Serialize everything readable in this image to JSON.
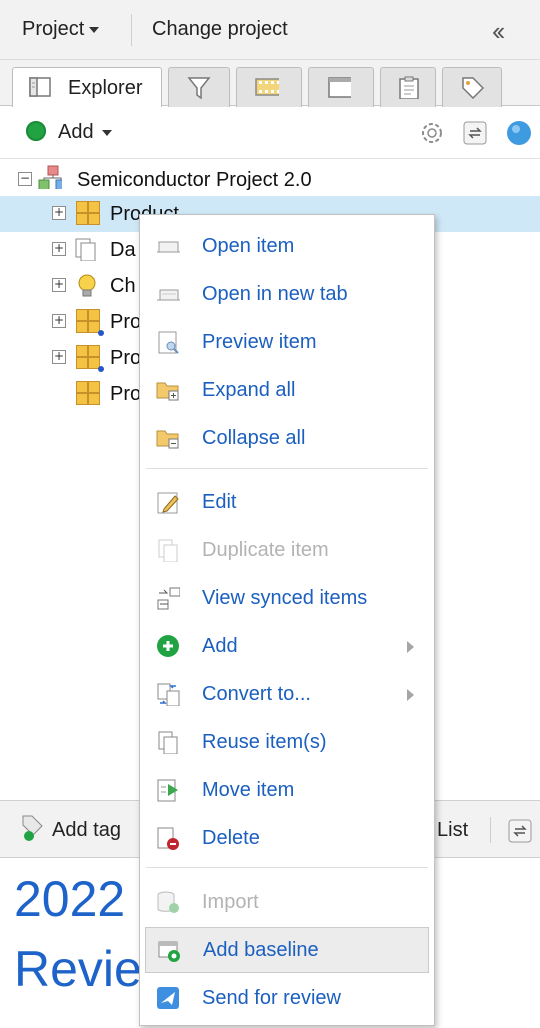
{
  "header": {
    "project_label": "Project",
    "change_project_label": "Change project",
    "collapse_icon": "double-chevron-left-icon"
  },
  "tabs": [
    {
      "label": "Explorer",
      "icon": "explorer-icon",
      "active": true
    },
    {
      "label": "",
      "icon": "filter-icon"
    },
    {
      "label": "",
      "icon": "film-strip-icon"
    },
    {
      "label": "",
      "icon": "window-icon"
    },
    {
      "label": "",
      "icon": "clipboard-icon"
    },
    {
      "label": "",
      "icon": "tag-icon"
    }
  ],
  "toolbar": {
    "add_label": "Add"
  },
  "tree": {
    "root": "Semiconductor Project 2.0",
    "items": [
      {
        "label": "Product",
        "selected": true
      },
      {
        "label": "Da"
      },
      {
        "label": "Ch"
      },
      {
        "label": "Pro"
      },
      {
        "label": "Pro"
      },
      {
        "label": "Pro"
      }
    ]
  },
  "bottom": {
    "add_tag_label": "Add tag",
    "list_label": "List",
    "heading_line1": "2022",
    "heading_line2": "Revie"
  },
  "context_menu": {
    "items": [
      {
        "label": "Open item",
        "icon": "open-item-icon"
      },
      {
        "label": "Open in new tab",
        "icon": "open-new-tab-icon"
      },
      {
        "label": "Preview item",
        "icon": "preview-icon"
      },
      {
        "label": "Expand all",
        "icon": "expand-all-icon"
      },
      {
        "label": "Collapse all",
        "icon": "collapse-all-icon"
      },
      {
        "label": "Edit",
        "icon": "pencil-icon"
      },
      {
        "label": "Duplicate item",
        "icon": "duplicate-icon",
        "disabled": true
      },
      {
        "label": "View synced items",
        "icon": "synced-items-icon"
      },
      {
        "label": "Add",
        "icon": "add-circle-icon",
        "submenu": true
      },
      {
        "label": "Convert to...",
        "icon": "convert-icon",
        "submenu": true
      },
      {
        "label": "Reuse item(s)",
        "icon": "reuse-icon"
      },
      {
        "label": "Move item",
        "icon": "move-item-icon"
      },
      {
        "label": "Delete",
        "icon": "delete-icon"
      },
      {
        "label": "Import",
        "icon": "import-icon",
        "disabled": true
      },
      {
        "label": "Add baseline",
        "icon": "baseline-icon",
        "hovered": true
      },
      {
        "label": "Send for review",
        "icon": "send-review-icon"
      }
    ]
  },
  "colors": {
    "accent_blue": "#1b5fbf",
    "selection": "#cfe8f7",
    "add_green": "#21a344",
    "delete_red": "#c0262d"
  }
}
